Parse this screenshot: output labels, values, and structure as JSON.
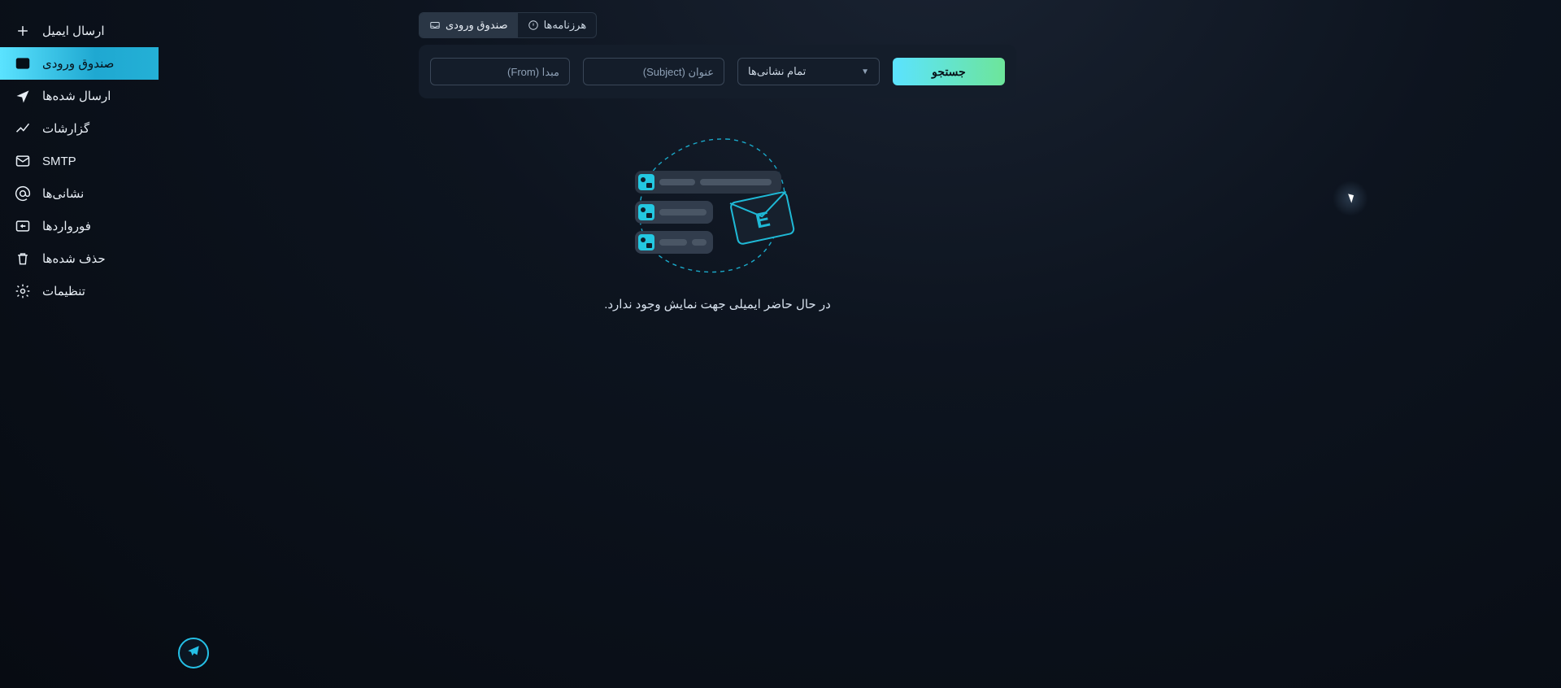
{
  "sidebar": {
    "items": [
      {
        "label": "ارسال ایمیل",
        "icon": "plus"
      },
      {
        "label": "صندوق ورودی",
        "icon": "inbox",
        "active": true
      },
      {
        "label": "ارسال شده‌ها",
        "icon": "send"
      },
      {
        "label": "گزارشات",
        "icon": "analytics"
      },
      {
        "label": "SMTP",
        "icon": "mail"
      },
      {
        "label": "نشانی‌ها",
        "icon": "at"
      },
      {
        "label": "فورواردها",
        "icon": "forward"
      },
      {
        "label": "حذف شده‌ها",
        "icon": "trash"
      },
      {
        "label": "تنظیمات",
        "icon": "gear"
      }
    ]
  },
  "tabs": {
    "inbox": {
      "label": "صندوق ورودی"
    },
    "spam": {
      "label": "هرزنامه‌ها"
    }
  },
  "search": {
    "from_placeholder": "مبدا (From)",
    "subject_placeholder": "عنوان (Subject)",
    "addresses_label": "تمام نشانی‌ها",
    "button_label": "جستجو"
  },
  "empty": {
    "text": "در حال حاضر ایمیلی جهت نمایش وجود ندارد."
  }
}
